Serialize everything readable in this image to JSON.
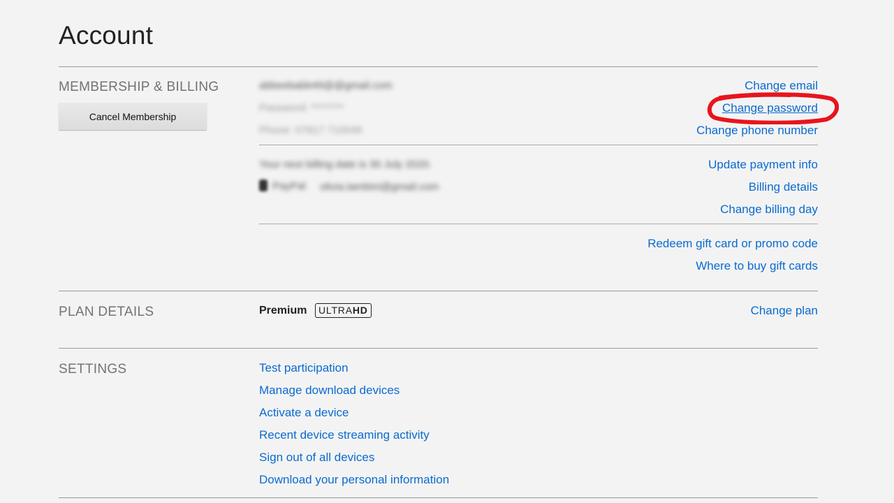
{
  "page": {
    "title": "Account"
  },
  "membership": {
    "label": "MEMBERSHIP & BILLING",
    "cancel_button": "Cancel Membership",
    "email_value": "abbeebabb49@@gmail.com",
    "password_value": "Password: ********",
    "phone_value": "Phone: 07817 710046",
    "links": {
      "change_email": "Change email",
      "change_password": "Change password",
      "change_phone": "Change phone number"
    },
    "billing": {
      "next_billing": "Your next billing date is 30 July 2020.",
      "payment_method": "PayPal",
      "payment_email": "olivia.tambini@gmail.com",
      "links": {
        "update_payment": "Update payment info",
        "billing_details": "Billing details",
        "change_billing_day": "Change billing day"
      }
    },
    "gift": {
      "redeem": "Redeem gift card or promo code",
      "where_to_buy": "Where to buy gift cards"
    }
  },
  "plan": {
    "label": "PLAN DETAILS",
    "name": "Premium",
    "badge_light": "ULTRA",
    "badge_bold": "HD",
    "change_plan": "Change plan"
  },
  "settings": {
    "label": "SETTINGS",
    "items": [
      "Test participation",
      "Manage download devices",
      "Activate a device",
      "Recent device streaming activity",
      "Sign out of all devices",
      "Download your personal information"
    ]
  },
  "colors": {
    "link": "#0a6bd1",
    "background": "#f3f3f3",
    "annotation": "#e8141c"
  },
  "icons": {
    "payment": "paypal-icon"
  }
}
